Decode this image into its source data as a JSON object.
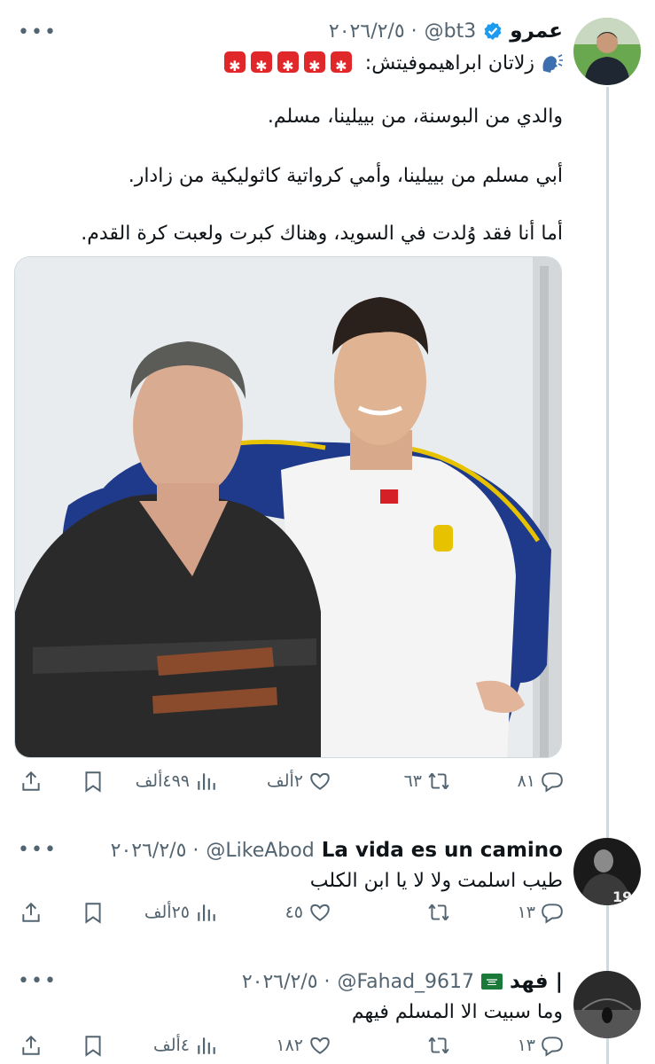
{
  "tweets": [
    {
      "name": "عمرو",
      "handle": "@bt3",
      "time": "٢٠٢٦/٢/٥ ·",
      "verified": true,
      "line1": "زلاتان ابراهيموفيتش:",
      "para1": "والدي من البوسنة، من بييلينا، مسلم.",
      "para2": "أبي مسلم من بييلينا، وأمي كرواتية كاثوليكية من زادار.",
      "para3": "أما أنا فقد وُلدت في السويد، وهناك كبرت ولعبت كرة القدم.",
      "stats": {
        "replies": "٨١",
        "retweets": "٦٣",
        "likes": "٢ألف",
        "views": "٤٩٩ألف"
      }
    },
    {
      "name": "La vida es un camino",
      "handle": "@LikeAbod",
      "time": "٢٠٢٦/٢/٥ ·",
      "text": "طيب اسلمت ولا لا يا ابن الكلب",
      "stats": {
        "replies": "١٣",
        "retweets": "",
        "likes": "٤٥",
        "views": "٢٥ألف"
      }
    },
    {
      "name": "فهد |",
      "handle": "@Fahad_9617",
      "time": "٢٠٢٦/٢/٥ ·",
      "text": "وما سبيت الا المسلم فيهم",
      "stats": {
        "replies": "١٣",
        "retweets": "",
        "likes": "١٨٢",
        "views": "٤ألف"
      }
    }
  ],
  "more_label": "•••",
  "icons": [
    "reply-icon",
    "retweet-icon",
    "like-icon",
    "views-icon",
    "bookmark-icon",
    "share-icon",
    "verified-icon",
    "speaking-head-icon",
    "siren-icon",
    "saudi-flag-icon"
  ],
  "colors": {
    "text": "#0f1419",
    "secondary": "#536471",
    "verified": "#1d9bf0",
    "divider": "#cfd9de",
    "siren": "#e0272a"
  }
}
